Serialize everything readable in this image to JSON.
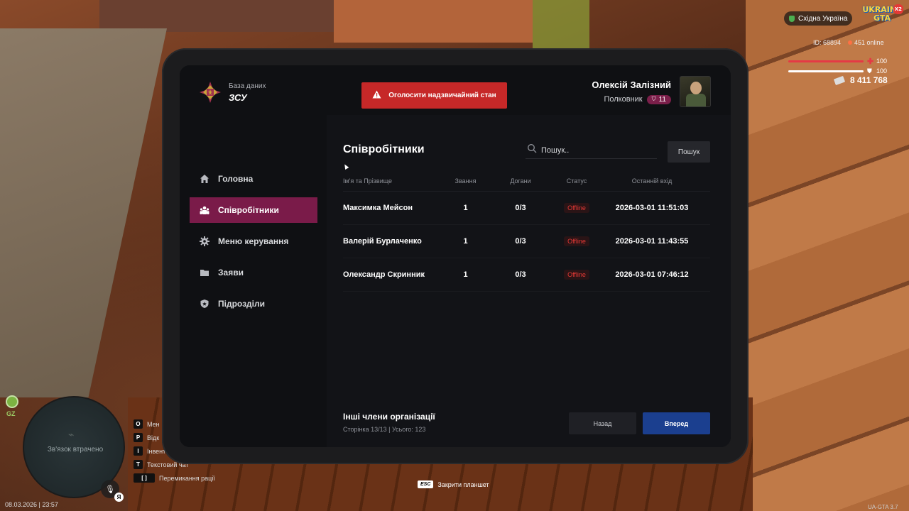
{
  "hud": {
    "region": "Східна Україна",
    "logo_line1": "UKRAINE",
    "logo_line2": "GTA",
    "logo_multiplier": "X2",
    "player_id": "ID: 68894",
    "online": "451 online",
    "health_value": "100",
    "armor_value": "100",
    "money": "8 411 768",
    "health_color": "#e53945",
    "armor_color": "#ffffff"
  },
  "minimap": {
    "status": "Зв'язок втрачено",
    "zone": "GZ",
    "voice_key": "Я",
    "datetime": "08.03.2026 | 23:57"
  },
  "keybinds": [
    {
      "key": "O",
      "label": "Мен"
    },
    {
      "key": "P",
      "label": "Відк"
    },
    {
      "key": "I",
      "label": "Інвент"
    },
    {
      "key": "T",
      "label": "Текстовий чат"
    },
    {
      "key": "[ ]",
      "label": "Перемикання рації"
    }
  ],
  "esc_hint": {
    "key": "ESC",
    "label": "Закрити планшет"
  },
  "version": "UA-GTA 3.7",
  "tablet": {
    "brand_sub": "База даних",
    "brand_title": "ЗСУ",
    "alarm_button": "Оголосити надзвичайний стан",
    "profile": {
      "name": "Олексій Залізний",
      "rank": "Полковник",
      "rank_level": "11"
    },
    "nav": [
      {
        "label": "Головна",
        "icon": "home-icon"
      },
      {
        "label": "Співробітники",
        "icon": "users-icon",
        "active": true
      },
      {
        "label": "Меню керування",
        "icon": "gear-icon"
      },
      {
        "label": "Заяви",
        "icon": "folder-icon"
      },
      {
        "label": "Підрозділи",
        "icon": "shield-icon"
      }
    ],
    "page_title": "Співробітники",
    "search": {
      "placeholder": "Пошук..",
      "button": "Пошук"
    },
    "table": {
      "headers": [
        "Ім'я та Прізвище",
        "Звання",
        "Догани",
        "Статус",
        "Останній вхід"
      ],
      "rows": [
        {
          "name": "Максимка Мейсон",
          "rank": "1",
          "warnings": "0/3",
          "status": "Offline",
          "last": "2026-03-01 11:51:03"
        },
        {
          "name": "Валерій Бурлаченко",
          "rank": "1",
          "warnings": "0/3",
          "status": "Offline",
          "last": "2026-03-01 11:43:55"
        },
        {
          "name": "Олександр Скринник",
          "rank": "1",
          "warnings": "0/3",
          "status": "Offline",
          "last": "2026-03-01 07:46:12"
        }
      ]
    },
    "footer": {
      "title": "Інші члени організації",
      "pagination": "Сторінка 13/13 | Усього: 123",
      "back": "Назад",
      "next": "Вперед"
    },
    "colors": {
      "accent": "#7a1b49",
      "alarm": "#c62828",
      "primary": "#1b3f8f",
      "offline": "#e53935"
    }
  }
}
